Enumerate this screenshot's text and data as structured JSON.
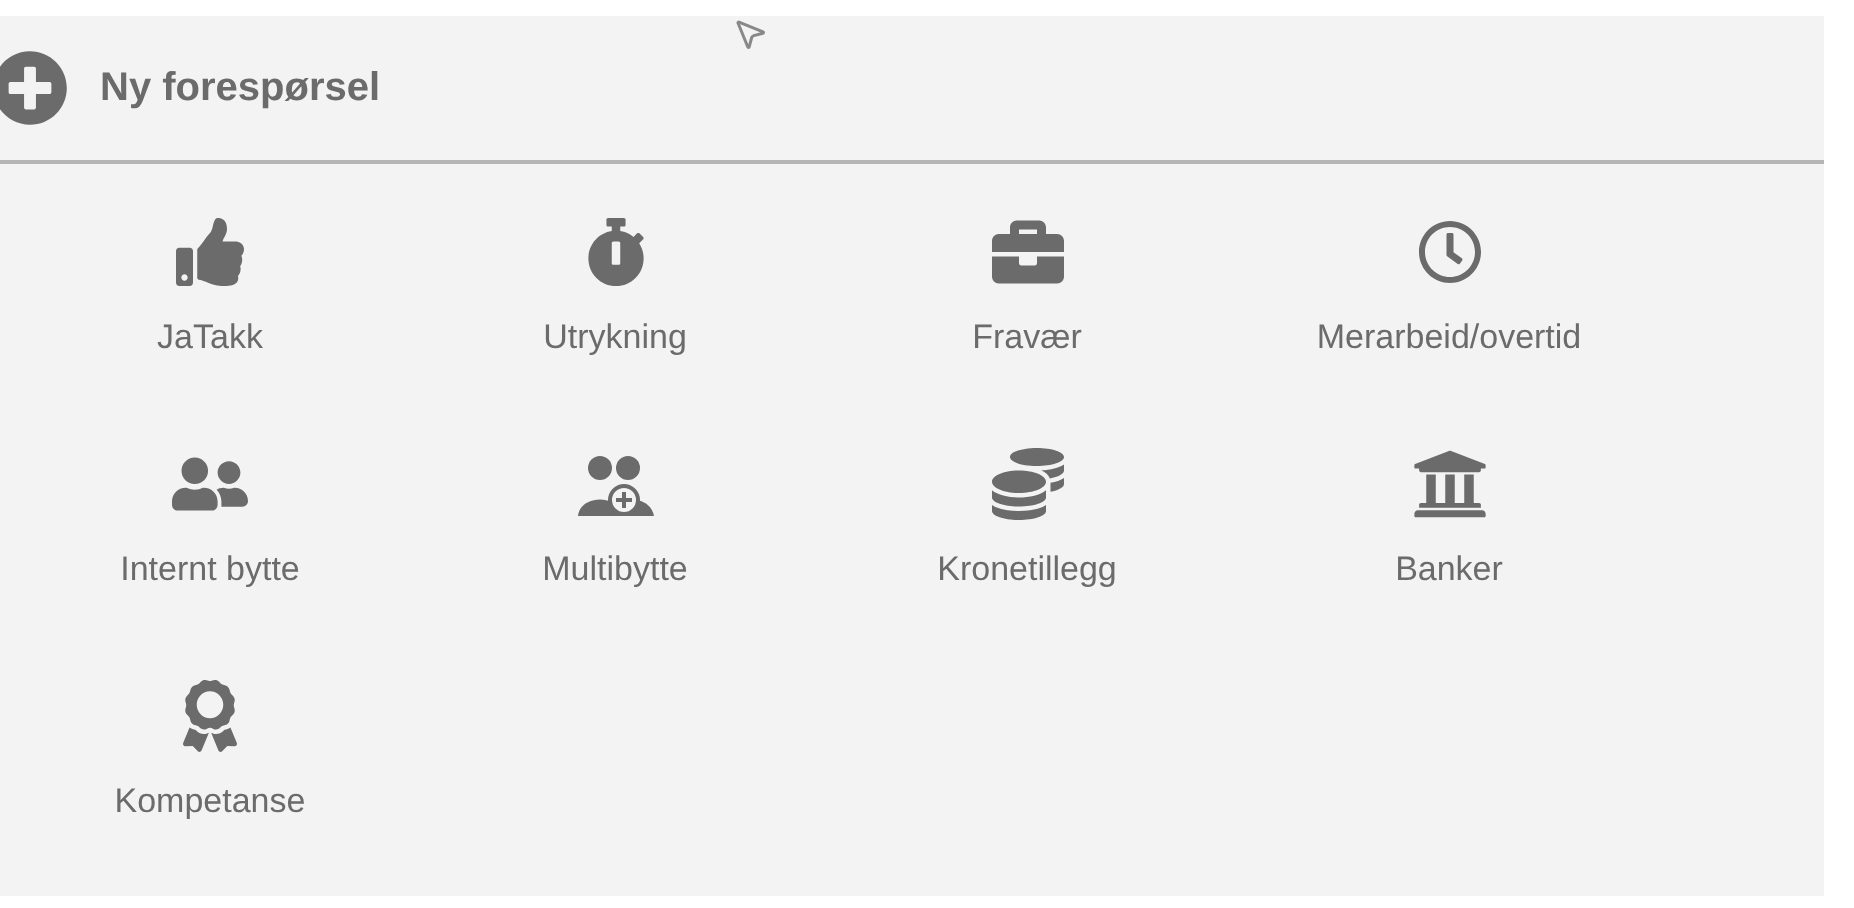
{
  "header": {
    "title": "Ny forespørsel"
  },
  "items": [
    {
      "kind": "thumbs-up",
      "label": "JaTakk"
    },
    {
      "kind": "stopwatch",
      "label": "Utrykning"
    },
    {
      "kind": "briefcase",
      "label": "Fravær"
    },
    {
      "kind": "clock",
      "label": "Merarbeid/overtid"
    },
    {
      "kind": "people",
      "label": "Internt bytte"
    },
    {
      "kind": "people-plus",
      "label": "Multibytte"
    },
    {
      "kind": "coins",
      "label": "Kronetillegg"
    },
    {
      "kind": "bank",
      "label": "Banker"
    },
    {
      "kind": "award",
      "label": "Kompetanse"
    }
  ]
}
